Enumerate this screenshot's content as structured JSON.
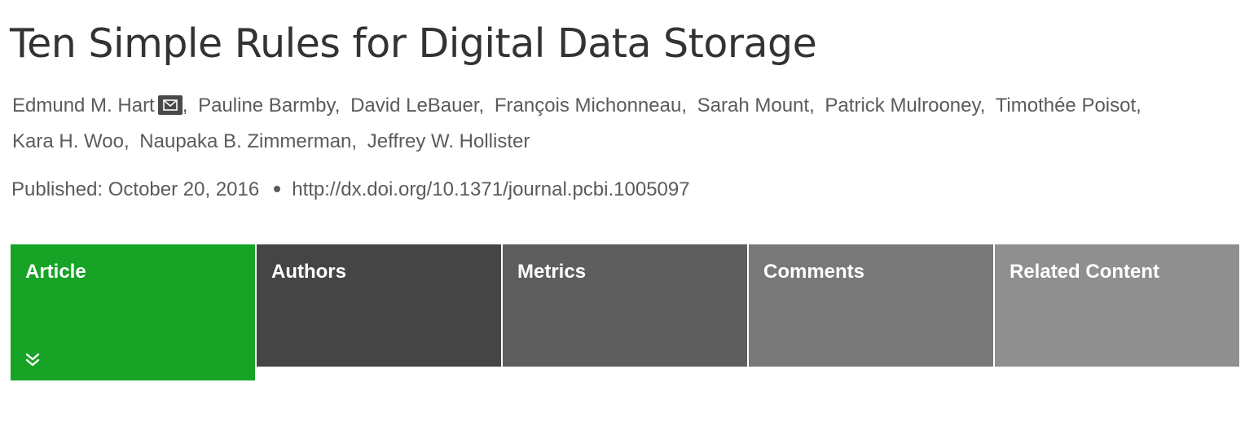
{
  "article": {
    "title": "Ten Simple Rules for Digital Data Storage",
    "authors": [
      {
        "name": "Edmund M. Hart",
        "sep": ",",
        "has_email": true
      },
      {
        "name": "Pauline Barmby",
        "sep": ","
      },
      {
        "name": "David LeBauer",
        "sep": ","
      },
      {
        "name": "François Michonneau",
        "sep": ","
      },
      {
        "name": "Sarah Mount",
        "sep": ","
      },
      {
        "name": "Patrick Mulrooney",
        "sep": ","
      },
      {
        "name": "Timothée Poisot",
        "sep": ","
      },
      {
        "name": "Kara H. Woo",
        "sep": ","
      },
      {
        "name": "Naupaka B. Zimmerman",
        "sep": ","
      },
      {
        "name": "Jeffrey W. Hollister",
        "sep": ""
      }
    ],
    "published": "Published: October 20, 2016",
    "doi": "http://dx.doi.org/10.1371/journal.pcbi.1005097"
  },
  "tabs": [
    {
      "label": "Article",
      "active": true,
      "color": "#16a326"
    },
    {
      "label": "Authors",
      "active": false,
      "color": "#454545"
    },
    {
      "label": "Metrics",
      "active": false,
      "color": "#5e5e5e"
    },
    {
      "label": "Comments",
      "active": false,
      "color": "#787878"
    },
    {
      "label": "Related Content",
      "active": false,
      "color": "#8f8f8f"
    }
  ],
  "icons": {
    "email": "envelope-icon",
    "expand": "double-chevron-down-icon"
  }
}
